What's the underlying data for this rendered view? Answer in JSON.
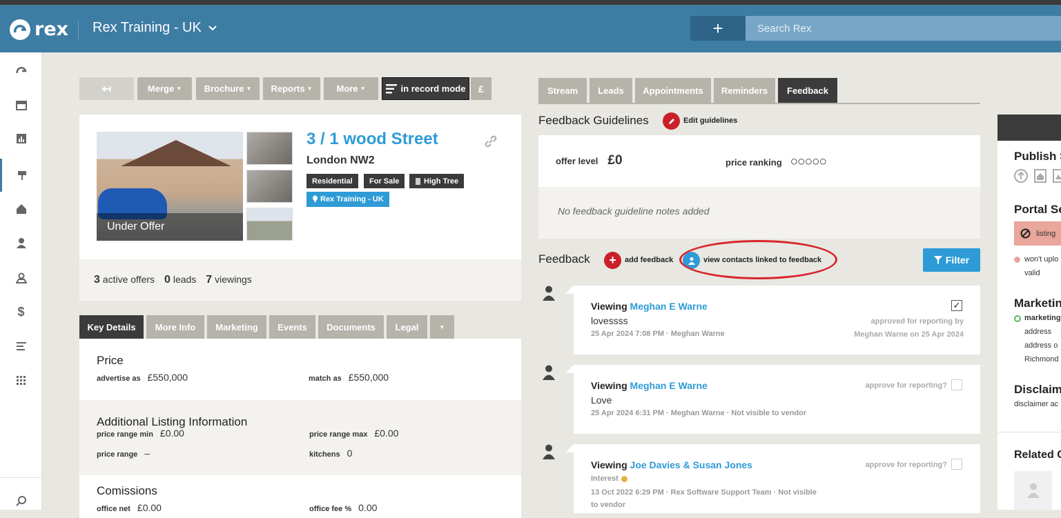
{
  "header": {
    "logo_text": "rex",
    "account_name": "Rex Training - UK",
    "search_placeholder": "Search Rex",
    "plus_label": "+"
  },
  "sidebar": {
    "icons": [
      "dashboard-icon",
      "calendar-icon",
      "reports-icon",
      "listings-icon",
      "properties-icon",
      "contacts-icon",
      "map-icon",
      "finance-icon",
      "lists-icon",
      "apps-icon"
    ],
    "bottom_icon": "search-icon"
  },
  "toolbar": {
    "back": "↤",
    "merge": "Merge",
    "brochure": "Brochure",
    "reports": "Reports",
    "more": "More",
    "record_mode": "in record mode",
    "pound": "£"
  },
  "listing": {
    "status_overlay": "Under Offer",
    "title": "3 / 1 wood Street",
    "subtitle": "London NW2",
    "tags": [
      "Residential",
      "For Sale",
      "High Tree"
    ],
    "office_tag": "Rex Training - UK",
    "stats": {
      "offers_count": "3",
      "offers_label": "active offers",
      "leads_count": "0",
      "leads_label": "leads",
      "viewings_count": "7",
      "viewings_label": "viewings"
    }
  },
  "listing_tabs": [
    "Key Details",
    "More Info",
    "Marketing",
    "Events",
    "Documents",
    "Legal"
  ],
  "details": {
    "price": {
      "heading": "Price",
      "advertise_as_label": "advertise as",
      "advertise_as": "£550,000",
      "match_as_label": "match as",
      "match_as": "£550,000"
    },
    "additional": {
      "heading": "Additional Listing Information",
      "price_range_min_label": "price range min",
      "price_range_min": "£0.00",
      "price_range_max_label": "price range max",
      "price_range_max": "£0.00",
      "price_range_label": "price range",
      "price_range": "–",
      "kitchens_label": "kitchens",
      "kitchens": "0"
    },
    "commissions": {
      "heading": "Comissions",
      "office_net_label": "office net",
      "office_net": "£0.00",
      "office_fee_label": "office fee %",
      "office_fee": "0.00"
    }
  },
  "right_tabs": [
    "Stream",
    "Leads",
    "Appointments",
    "Reminders",
    "Feedback"
  ],
  "guidelines": {
    "title": "Feedback Guidelines",
    "edit_label": "Edit guidelines",
    "offer_level_label": "offer level",
    "offer_level": "£0",
    "price_ranking_label": "price ranking",
    "price_ranking_display": "○○○○○",
    "notes": "No feedback guideline notes added"
  },
  "feedback": {
    "title": "Feedback",
    "add_label": "add feedback",
    "view_contacts_label": "view contacts linked to feedback",
    "filter_label": "Filter",
    "items": [
      {
        "prefix": "Viewing",
        "name": "Meghan E Warne",
        "body": "lovessss",
        "meta": "25 Apr 2024 7:08 PM · Meghan Warne",
        "right_line1": "approved for reporting by",
        "right_line2": "Meghan Warne on 25 Apr 2024"
      },
      {
        "prefix": "Viewing",
        "name": "Meghan E Warne",
        "body": "Love",
        "meta": "25 Apr 2024 6:31 PM · Meghan Warne · Not visible to vendor",
        "approve_label": "approve for reporting?"
      },
      {
        "prefix": "Viewing",
        "name": "Joe Davies & Susan Jones",
        "interest": "Interest",
        "meta_line1": "13 Oct 2022 6:29 PM · Rex Software Support Team · Not visible",
        "meta_line2": "to vendor",
        "approve_label": "approve for reporting?"
      }
    ]
  },
  "right_panel": {
    "publish": "Publish S",
    "portal": "Portal Se",
    "listing_status": "listing",
    "wont_upload": "won't uplo",
    "valid": "valid",
    "marketing": "Marketin",
    "marketing_item": "marketing",
    "address": "address",
    "address_o": "address o",
    "richmond": "Richmond",
    "disclaimer": "Disclaime",
    "disclaimer_text": "disclaimer ac",
    "related": "Related C"
  }
}
